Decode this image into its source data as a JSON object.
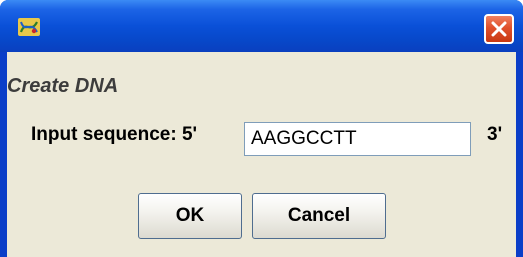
{
  "window": {
    "icon": "dna-app-icon",
    "close_icon": "close-icon"
  },
  "dialog": {
    "header": "Create DNA",
    "input_label": "Input sequence: 5'",
    "input_value": "AAGGCCTT",
    "suffix_label": "3'"
  },
  "buttons": {
    "ok_label": "OK",
    "cancel_label": "Cancel"
  },
  "colors": {
    "titlebar": "#0a50d8",
    "close_button": "#e0502c",
    "dialog_background": "#ece9d8"
  }
}
